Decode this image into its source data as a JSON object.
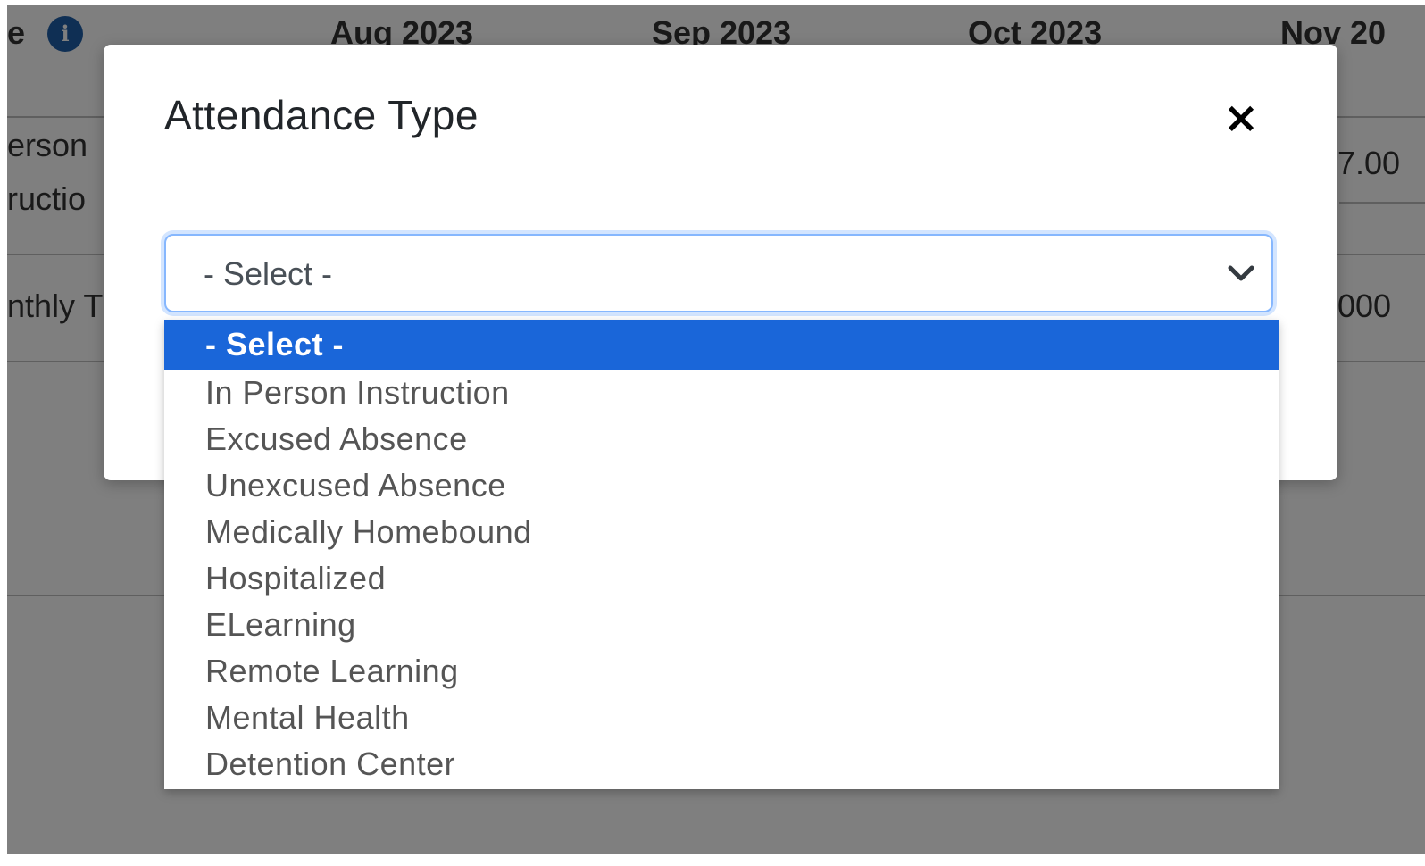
{
  "background": {
    "header_prefix": "e",
    "months": [
      "Aug 2023",
      "Sep 2023",
      "Oct 2023",
      "Nov 20"
    ],
    "row1_label_line1": "erson",
    "row1_label_line2": "ructio",
    "row1_value": "7.00",
    "row2_label": "nthly T",
    "row2_value": "000"
  },
  "modal": {
    "title": "Attendance Type",
    "close_label": "×",
    "select": {
      "value": "- Select -"
    },
    "options": [
      "- Select -",
      "In Person Instruction",
      "Excused Absence",
      "Unexcused Absence",
      "Medically Homebound",
      "Hospitalized",
      "ELearning",
      "Remote Learning",
      "Mental Health",
      "Detention Center"
    ],
    "selected_index": 0
  },
  "colors": {
    "selected_option_bg": "#1a66d9",
    "select_focus_border": "#86b7fe",
    "info_icon": "#1e5ea8"
  }
}
